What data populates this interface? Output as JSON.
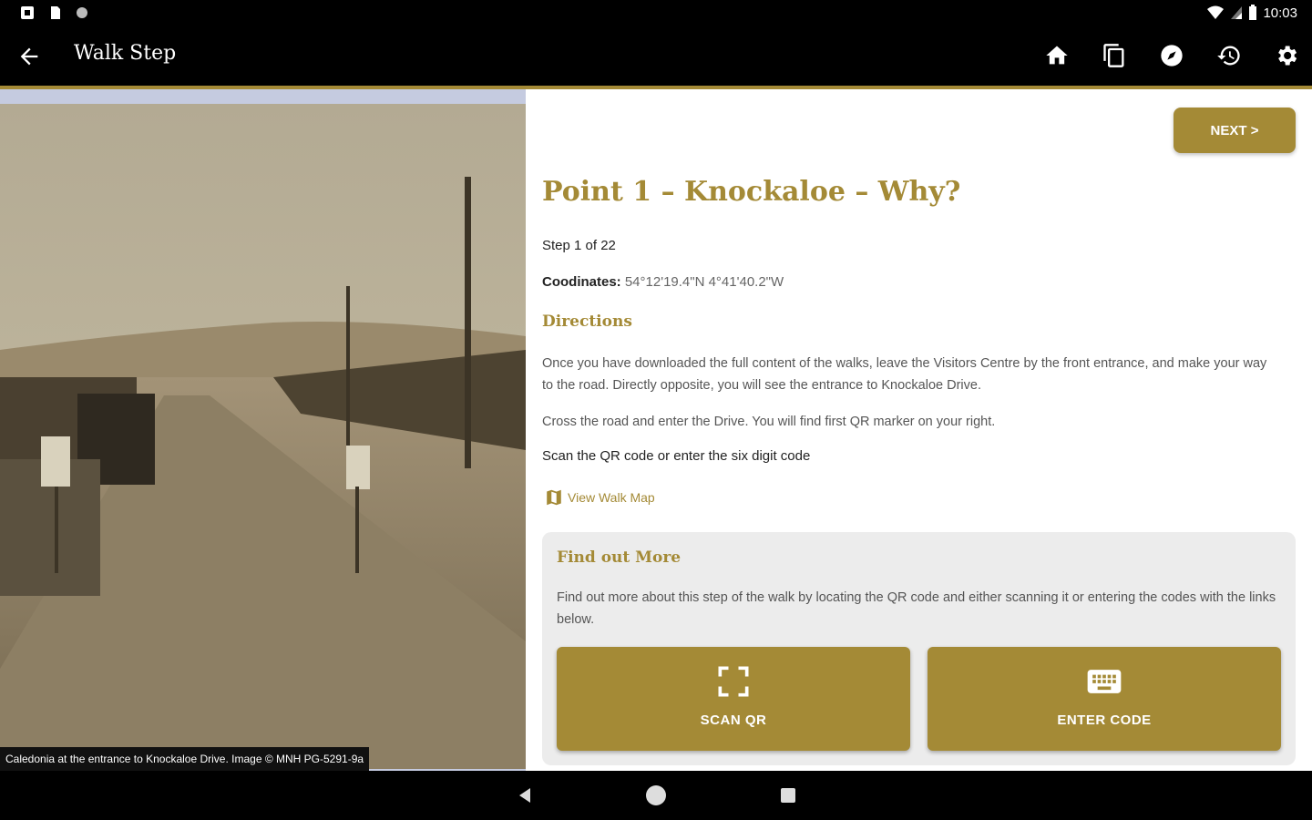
{
  "status_bar": {
    "time": "10:03"
  },
  "app_bar": {
    "title": "Walk Step"
  },
  "photo": {
    "caption": "Caledonia at the entrance to Knockaloe Drive. Image © MNH PG-5291-9a"
  },
  "content": {
    "next_label": "NEXT >",
    "heading": "Point 1 – Knockaloe – Why?",
    "step_text": "Step 1 of 22",
    "coords_label": "Coodinates:",
    "coords_value": "54°12'19.4\"N 4°41'40.2\"W",
    "directions_title": "Directions",
    "paragraph1": "Once you have downloaded the full content of the walks, leave the Visitors Centre by the front entrance, and make your way to the road. Directly opposite, you will see the entrance to Knockaloe Drive.",
    "paragraph2": "Cross the road and enter the Drive. You will find first QR marker on your right.",
    "scan_hint": "Scan the QR code or enter the six digit code",
    "map_link": "View Walk Map"
  },
  "find_out_more": {
    "title": "Find out More",
    "text": "Find out more about this step of the walk by locating the QR code and either scanning it or entering the codes with the links below.",
    "scan_label": "SCAN QR",
    "enter_label": "ENTER CODE"
  },
  "colors": {
    "accent": "#a48a36",
    "card_bg": "#ececec"
  }
}
